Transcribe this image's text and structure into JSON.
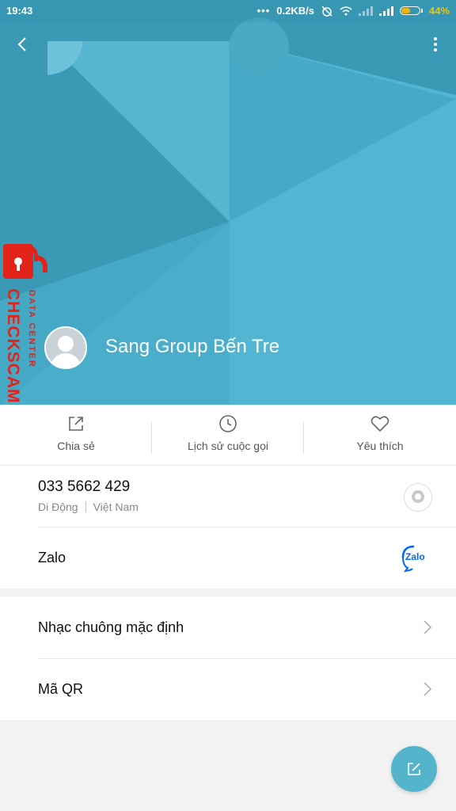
{
  "status_bar": {
    "time": "19:43",
    "speed": "0.2KB/s",
    "battery_pct": "44%",
    "battery_level": 0.44
  },
  "contact": {
    "name": "Sang Group Bến Tre"
  },
  "watermark": {
    "text_main": "CHECKSCAM.INFO",
    "text_side": "DATA CENTER"
  },
  "actions": [
    {
      "label": "Chia sẻ",
      "icon": "share-icon"
    },
    {
      "label": "Lịch sử cuộc gọi",
      "icon": "clock-icon"
    },
    {
      "label": "Yêu thích",
      "icon": "heart-icon"
    }
  ],
  "phone": {
    "number": "033 5662 429",
    "type": "Di Động",
    "region": "Việt Nam"
  },
  "zalo": {
    "label": "Zalo",
    "icon_text": "Zalo"
  },
  "menu": [
    {
      "label": "Nhạc chuông mặc định"
    },
    {
      "label": "Mã QR"
    }
  ],
  "colors": {
    "header": "#3f9fb9",
    "fab": "#54b4cc",
    "watermark": "#e2231a"
  }
}
